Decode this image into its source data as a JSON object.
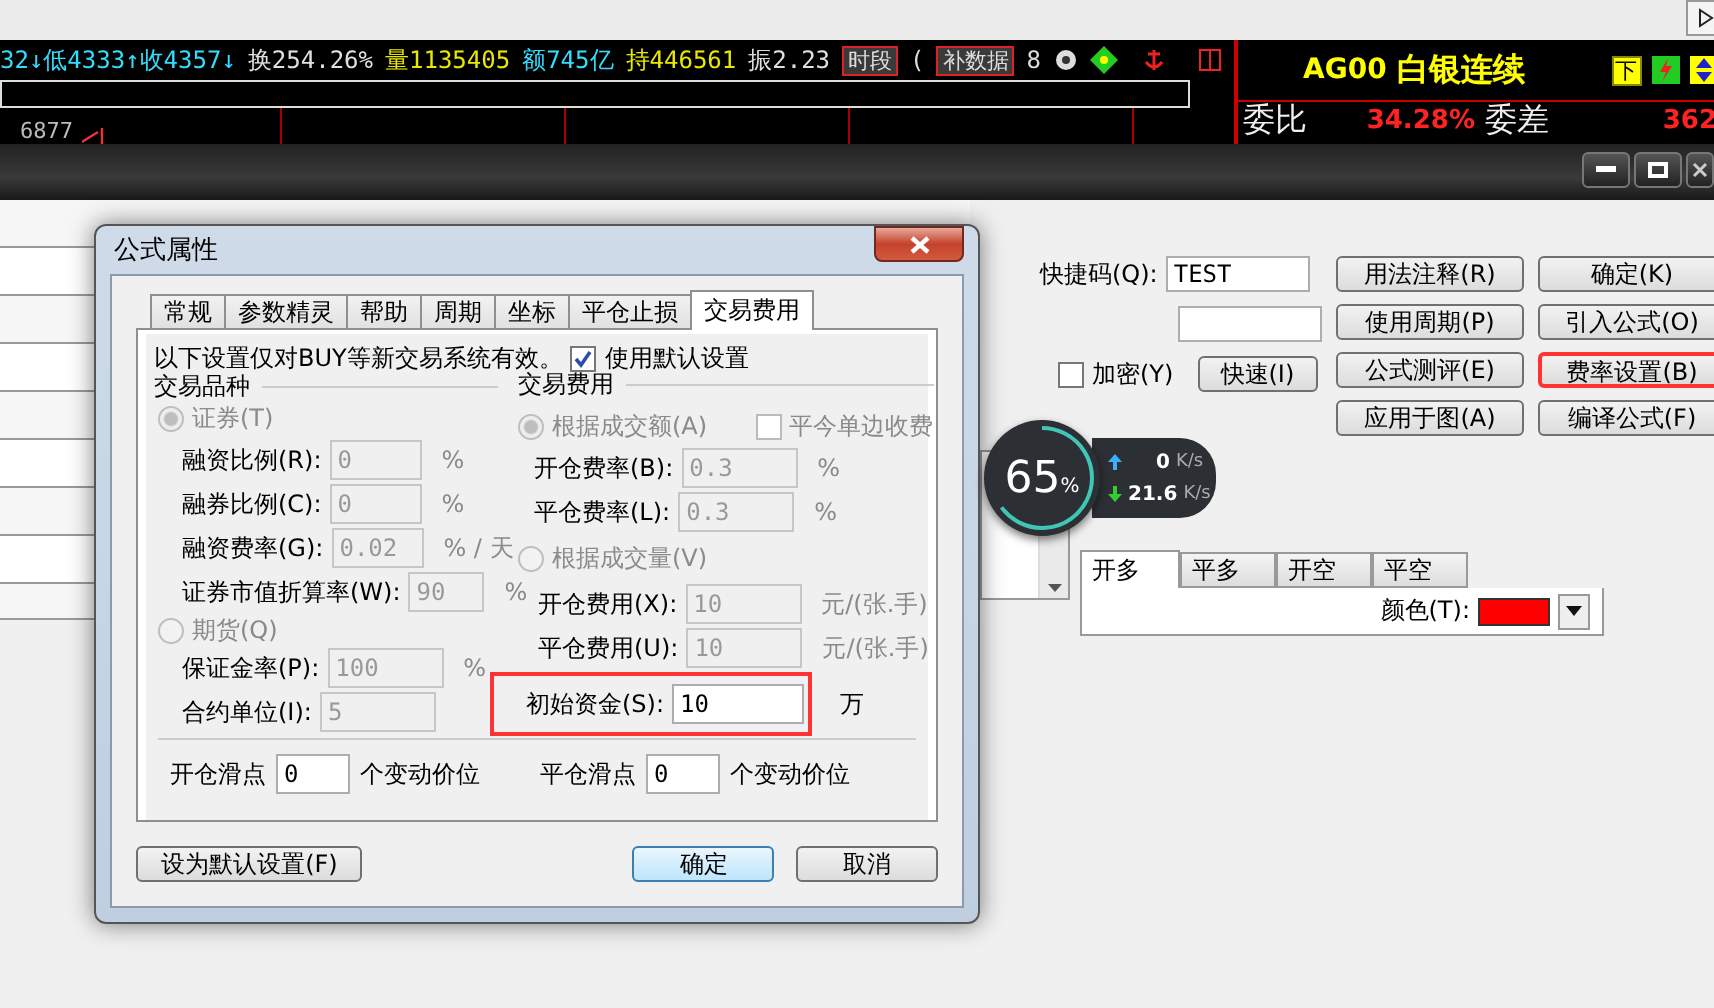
{
  "quote_bar": {
    "segments": [
      {
        "text": "32↓低4333↑收4357↓",
        "color": "#33ddff"
      },
      {
        "text": "换254.26%",
        "color": "#e0e0e0"
      },
      {
        "text": "量1135405",
        "color": "#e8e800"
      },
      {
        "text": "额745亿",
        "color": "#33ddff"
      },
      {
        "text": "持446561",
        "color": "#e8e800"
      },
      {
        "text": "振2.23",
        "color": "#e0e0e0"
      }
    ],
    "period_badge": "时段",
    "bracket": "(",
    "fill_badge": "补数据",
    "trailing": "8"
  },
  "chart": {
    "price_label": "6877"
  },
  "contract_panel": {
    "code": "AG00",
    "name": "白银连续",
    "flag": "下",
    "ratio_label": "委比",
    "ratio": "34.28%",
    "diff_label": "委差",
    "diff": "362"
  },
  "editor": {
    "shortcut_label": "快捷码(Q):",
    "shortcut_value": "TEST",
    "encrypt": {
      "label": "加密(Y)",
      "checked": false
    },
    "fast_button": "快速(I)",
    "buttons": [
      {
        "label": "用法注释(R)",
        "highlighted": false
      },
      {
        "label": "确定(K)",
        "highlighted": false
      },
      {
        "label": "使用周期(P)",
        "highlighted": false
      },
      {
        "label": "引入公式(O)",
        "highlighted": false
      },
      {
        "label": "公式测评(E)",
        "highlighted": false
      },
      {
        "label": "费率设置(B)",
        "highlighted": true
      },
      {
        "label": "应用于图(A)",
        "highlighted": false
      },
      {
        "label": "编译公式(F)",
        "highlighted": false
      }
    ],
    "net_widget": {
      "percent": "65",
      "percent_unit": "%",
      "up": "0",
      "up_unit": "K/s",
      "down": "21.6",
      "down_unit": "K/s"
    },
    "signal_tabs": [
      {
        "label": "开多",
        "selected": true
      },
      {
        "label": "平多",
        "selected": false
      },
      {
        "label": "开空",
        "selected": false
      },
      {
        "label": "平空",
        "selected": false
      }
    ],
    "color_label": "颜色(T):"
  },
  "dialog": {
    "title": "公式属性",
    "tabs": [
      {
        "label": "常规",
        "selected": false
      },
      {
        "label": "参数精灵",
        "selected": false
      },
      {
        "label": "帮助",
        "selected": false
      },
      {
        "label": "周期",
        "selected": false
      },
      {
        "label": "坐标",
        "selected": false
      },
      {
        "label": "平仓止损",
        "selected": false
      },
      {
        "label": "交易费用",
        "selected": true
      }
    ],
    "notice": "以下设置仅对BUY等新交易系统有效。",
    "use_default": {
      "label": "使用默认设置",
      "checked": true
    },
    "instrument": {
      "title": "交易品种",
      "stock": {
        "label": "证券(T)",
        "selected": true,
        "disabled": true
      },
      "stock_fields": [
        {
          "label": "融资比例(R):",
          "value": "0",
          "unit": "%",
          "disabled": true
        },
        {
          "label": "融券比例(C):",
          "value": "0",
          "unit": "%",
          "disabled": true
        },
        {
          "label": "融资费率(G):",
          "value": "0.02",
          "unit": "% / 天",
          "disabled": true
        },
        {
          "label": "证券市值折算率(W):",
          "value": "90",
          "unit": "%",
          "disabled": true
        }
      ],
      "futures": {
        "label": "期货(Q)",
        "selected": false,
        "disabled": true
      },
      "futures_fields": [
        {
          "label": "保证金率(P):",
          "value": "100",
          "unit": "%",
          "disabled": true
        },
        {
          "label": "合约单位(I):",
          "value": "5",
          "disabled": true
        }
      ]
    },
    "fees": {
      "title": "交易费用",
      "by_amount": {
        "label": "根据成交额(A)",
        "selected": true,
        "disabled": true
      },
      "close_today_one_side": {
        "label": "平今单边收费",
        "checked": false,
        "disabled": true
      },
      "amount_fields": [
        {
          "label": "开仓费率(B):",
          "value": "0.3",
          "unit": "%",
          "disabled": true
        },
        {
          "label": "平仓费率(L):",
          "value": "0.3",
          "unit": "%",
          "disabled": true
        }
      ],
      "by_volume": {
        "label": "根据成交量(V)",
        "selected": false,
        "disabled": true
      },
      "volume_fields": [
        {
          "label": "开仓费用(X):",
          "value": "10",
          "unit": "元/(张.手)",
          "disabled": true
        },
        {
          "label": "平仓费用(U):",
          "value": "10",
          "unit": "元/(张.手)",
          "disabled": true
        }
      ],
      "initial_capital": {
        "label": "初始资金(S):",
        "value": "10",
        "unit": "万",
        "disabled": false,
        "highlighted": true
      }
    },
    "slippage": [
      {
        "label": "开仓滑点",
        "value": "0",
        "unit": "个变动价位"
      },
      {
        "label": "平仓滑点",
        "value": "0",
        "unit": "个变动价位"
      }
    ],
    "buttons": [
      {
        "label": "设为默认设置(F)",
        "default": false
      },
      {
        "label": "确定",
        "default": true
      },
      {
        "label": "取消",
        "default": false
      }
    ]
  }
}
